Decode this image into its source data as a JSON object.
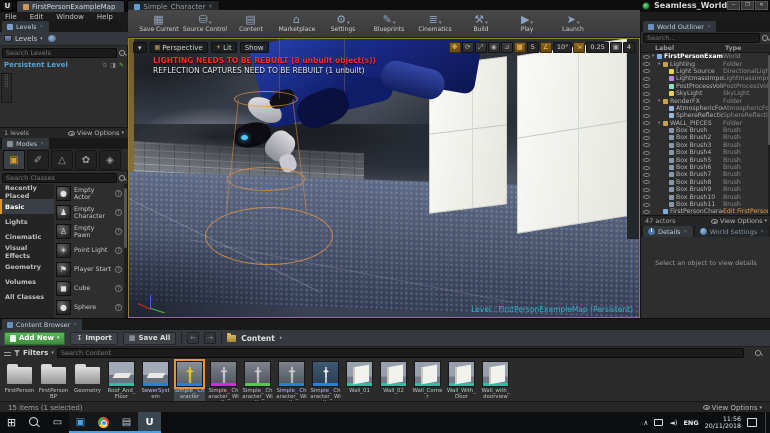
{
  "window": {
    "logo": "U",
    "tabs": [
      {
        "label": "FirstPersonExampleMap",
        "active": true,
        "icon_color": "#c9995a",
        "close": ""
      },
      {
        "label": "Simple_Character",
        "active": false,
        "icon_color": "#5a9fd8",
        "close": "✕"
      }
    ],
    "project_title": "Seamless_Worlds",
    "menu_items": [
      "File",
      "Edit",
      "Window",
      "Help"
    ],
    "controls": [
      {
        "id": "minimize",
        "g": "─"
      },
      {
        "id": "maximize",
        "g": "❐"
      },
      {
        "id": "close",
        "g": "✕"
      }
    ]
  },
  "main_toolbar": {
    "buttons": [
      {
        "label": "Save Current",
        "glyph": "▦",
        "arrow": ""
      },
      {
        "label": "Source Control",
        "glyph": "⛁",
        "arrow": "▾"
      },
      {
        "label": "Content",
        "glyph": "▤",
        "arrow": ""
      },
      {
        "label": "Marketplace",
        "glyph": "⌂",
        "arrow": ""
      },
      {
        "label": "Settings",
        "glyph": "⚙",
        "arrow": "▾"
      },
      {
        "label": "Blueprints",
        "glyph": "✎",
        "arrow": "▾"
      },
      {
        "label": "Cinematics",
        "glyph": "≣",
        "arrow": "▾"
      },
      {
        "label": "Build",
        "glyph": "⚒",
        "arrow": "▾"
      },
      {
        "label": "Play",
        "glyph": "▶",
        "arrow": "▾"
      },
      {
        "label": "Launch",
        "glyph": "➤",
        "arrow": "▾"
      }
    ]
  },
  "levels_panel": {
    "tab": "Levels",
    "tab_close": "✕",
    "toolbar_label": "Levels",
    "search_placeholder": "Search Levels",
    "row": {
      "label": "Persistent Level"
    },
    "footer": "1 levels",
    "view_options": "View Options"
  },
  "modes_panel": {
    "tab": "Modes",
    "tab_close": "✕",
    "tools": [
      {
        "id": "place-mode",
        "g": "▣",
        "on": true
      },
      {
        "id": "paint-mode",
        "g": "✐"
      },
      {
        "id": "landscape-mode",
        "g": "△"
      },
      {
        "id": "foliage-mode",
        "g": "✿"
      },
      {
        "id": "geometry-mode",
        "g": "◈"
      }
    ],
    "search_placeholder": "Search Classes",
    "categories": [
      {
        "label": "Recently Placed"
      },
      {
        "label": "Basic",
        "sel": true
      },
      {
        "label": "Lights"
      },
      {
        "label": "Cinematic"
      },
      {
        "label": "Visual Effects"
      },
      {
        "label": "Geometry"
      },
      {
        "label": "Volumes"
      },
      {
        "label": "All Classes"
      }
    ],
    "items": [
      {
        "label": "Empty Actor",
        "g": "●",
        "q": "?"
      },
      {
        "label": "Empty Character",
        "g": "♟",
        "q": "?"
      },
      {
        "label": "Empty Pawn",
        "g": "♙",
        "q": "?"
      },
      {
        "label": "Point Light",
        "g": "☀",
        "q": "?"
      },
      {
        "label": "Player Start",
        "g": "⚑",
        "q": "?"
      },
      {
        "label": "Cube",
        "g": "◼",
        "q": "?"
      },
      {
        "label": "Sphere",
        "g": "●",
        "q": "?"
      }
    ]
  },
  "viewport": {
    "dropdown_arrow": "▾",
    "perspective_label": "Perspective",
    "lit_label": "Lit",
    "show_label": "Show",
    "warning_line1": "LIGHTING NEEDS TO BE REBUILT (8 unbuilt object(s))",
    "warning_line2": "REFLECTION CAPTURES NEED TO BE REBUILT (1 unbuilt)",
    "level_label": "Level : FirstPersonExampleMap (Persistent)",
    "colors": {
      "warning_red": "#ff2a2a",
      "level_teal": "#2fb3c4",
      "selection_orange": "#e8923a"
    },
    "transform_toolbar": [
      {
        "id": "move-tool",
        "g": "✥",
        "on": true
      },
      {
        "id": "rotate-tool",
        "g": "⟳"
      },
      {
        "id": "scale-tool",
        "g": "⤢"
      },
      {
        "id": "world-coord",
        "g": "◉"
      },
      {
        "id": "surface-snap",
        "g": "⊿"
      },
      {
        "id": "grid-snap",
        "g": "▦",
        "on": true
      },
      {
        "id": "grid-snap-value",
        "g": "5",
        "val": true
      },
      {
        "id": "angle-snap",
        "g": "∠",
        "on": true
      },
      {
        "id": "angle-snap-value",
        "g": "10°",
        "val": true
      },
      {
        "id": "scale-snap",
        "g": "⇲",
        "on": true
      },
      {
        "id": "scale-snap-value",
        "g": "0.25",
        "val": true
      },
      {
        "id": "camera-speed",
        "g": "▣"
      },
      {
        "id": "camera-speed-value",
        "g": "4",
        "val": true
      }
    ]
  },
  "world_outliner": {
    "tab": "World Outliner",
    "tab_close": "✕",
    "search_placeholder": "Search...",
    "col_label": "Label",
    "col_type": "Type",
    "rows": [
      {
        "ind": 0,
        "arrow": "▾",
        "ic": "#7fb2e8",
        "label": "FirstPersonExampleMap (Editor)",
        "type": "World",
        "lc": "#ffffff"
      },
      {
        "ind": 1,
        "arrow": "▾",
        "ic": "#c8a24a",
        "label": "Lighting",
        "type": "Folder"
      },
      {
        "ind": 2,
        "arrow": "",
        "ic": "#e8d44a",
        "label": "Light Source",
        "type": "DirectionalLight"
      },
      {
        "ind": 2,
        "arrow": "",
        "ic": "#b48ae0",
        "label": "LightmassImportanceVolume",
        "type": "LightmassImportan"
      },
      {
        "ind": 2,
        "arrow": "",
        "ic": "#8ae0c8",
        "label": "PostProcessVolume",
        "type": "PostProcessVolum"
      },
      {
        "ind": 2,
        "arrow": "",
        "ic": "#e8d44a",
        "label": "SkyLight",
        "type": "SkyLight"
      },
      {
        "ind": 1,
        "arrow": "▾",
        "ic": "#c8a24a",
        "label": "RenderFX",
        "type": "Folder"
      },
      {
        "ind": 2,
        "arrow": "",
        "ic": "#9ab8d8",
        "label": "AtmosphericFog",
        "type": "AtmosphericFog"
      },
      {
        "ind": 2,
        "arrow": "",
        "ic": "#9ab8d8",
        "label": "SphereReflectionCapture",
        "type": "SphereReflection"
      },
      {
        "ind": 1,
        "arrow": "▾",
        "ic": "#c8a24a",
        "label": "WALL_PIECES",
        "type": "Folder"
      },
      {
        "ind": 2,
        "arrow": "",
        "ic": "#8898a8",
        "label": "Box Brush",
        "type": "Brush"
      },
      {
        "ind": 2,
        "arrow": "",
        "ic": "#8898a8",
        "label": "Box Brush2",
        "type": "Brush"
      },
      {
        "ind": 2,
        "arrow": "",
        "ic": "#8898a8",
        "label": "Box Brush3",
        "type": "Brush"
      },
      {
        "ind": 2,
        "arrow": "",
        "ic": "#8898a8",
        "label": "Box Brush4",
        "type": "Brush"
      },
      {
        "ind": 2,
        "arrow": "",
        "ic": "#8898a8",
        "label": "Box Brush5",
        "type": "Brush"
      },
      {
        "ind": 2,
        "arrow": "",
        "ic": "#8898a8",
        "label": "Box Brush6",
        "type": "Brush"
      },
      {
        "ind": 2,
        "arrow": "",
        "ic": "#8898a8",
        "label": "Box Brush7",
        "type": "Brush"
      },
      {
        "ind": 2,
        "arrow": "",
        "ic": "#8898a8",
        "label": "Box Brush8",
        "type": "Brush"
      },
      {
        "ind": 2,
        "arrow": "",
        "ic": "#8898a8",
        "label": "Box Brush9",
        "type": "Brush"
      },
      {
        "ind": 2,
        "arrow": "",
        "ic": "#8898a8",
        "label": "Box Brush10",
        "type": "Brush"
      },
      {
        "ind": 2,
        "arrow": "",
        "ic": "#8898a8",
        "label": "Box Brush11",
        "type": "Brush"
      },
      {
        "ind": 1,
        "arrow": "",
        "ic": "#78b0e0",
        "label": "FirstPersonCharacter",
        "type": "Edit FirstPersonCh",
        "tc": "#e8a33d"
      }
    ],
    "footer": "47 actors",
    "view_options": "View Options"
  },
  "details_panel": {
    "tab_details": "Details",
    "tab_world_settings": "World Settings",
    "tab_close": "✕",
    "empty_text": "Select an object to view details"
  },
  "content_browser": {
    "tab": "Content Browser",
    "tab_close": "✕",
    "add_new": "Add New",
    "import": "Import",
    "save_all": "Save All",
    "back_arrow": "←",
    "forward_arrow": "→",
    "breadcrumb": "Content",
    "breadcrumb_chevron": "▸",
    "filters": "Filters",
    "search_placeholder": "Search Content",
    "status": "15 items (1 selected)",
    "view_options": "View Options",
    "assets": [
      {
        "label": "FirstPerson",
        "kind": "folder"
      },
      {
        "label": "FirstPerson BP",
        "kind": "folder"
      },
      {
        "label": "Geometry",
        "kind": "folder"
      },
      {
        "label": "Roof_And_ Floor",
        "kind": "asset",
        "art": "scene",
        "bar": "#27c2a4"
      },
      {
        "label": "SewerSystem",
        "kind": "asset",
        "art": "scene",
        "bar": "#2a7de0"
      },
      {
        "label": "Simple_ Character",
        "kind": "asset",
        "art": "char-yellow",
        "bar": "#2a7de0",
        "sel": true
      },
      {
        "label": "Simple_ Character_ With",
        "kind": "asset",
        "art": "char-gray",
        "bar": "#d42ad4"
      },
      {
        "label": "Simple_ Character_ With",
        "kind": "asset",
        "art": "char-gray",
        "bar": "#57c750"
      },
      {
        "label": "Simple_ Character_ With",
        "kind": "asset",
        "art": "char-gray",
        "bar": "#2a7de0"
      },
      {
        "label": "Simple_ Character_ With",
        "kind": "asset",
        "art": "skeleton",
        "bar": "#2a7de0"
      },
      {
        "label": "Wall_01",
        "kind": "asset",
        "art": "wall",
        "bar": "#27c2a4"
      },
      {
        "label": "Wall_02",
        "kind": "asset",
        "art": "wall",
        "bar": "#27c2a4"
      },
      {
        "label": "Wall_Corner",
        "kind": "asset",
        "art": "wall",
        "bar": "#27c2a4"
      },
      {
        "label": "Wall_With_ Door",
        "kind": "asset",
        "art": "wall",
        "bar": "#27c2a4"
      },
      {
        "label": "Wall_with_ doorview",
        "kind": "asset",
        "art": "wall",
        "bar": "#27c2a4"
      }
    ]
  },
  "taskbar": {
    "apps": [
      {
        "id": "start"
      },
      {
        "id": "search"
      },
      {
        "id": "taskview"
      },
      {
        "id": "vs",
        "active": true
      },
      {
        "id": "chrome",
        "active": true
      },
      {
        "id": "epic",
        "active": true
      },
      {
        "id": "unreal",
        "active": true
      }
    ],
    "tray": {
      "chevron": "∧",
      "lang": "ENG",
      "time": "11:56",
      "date": "20/11/2018"
    }
  }
}
